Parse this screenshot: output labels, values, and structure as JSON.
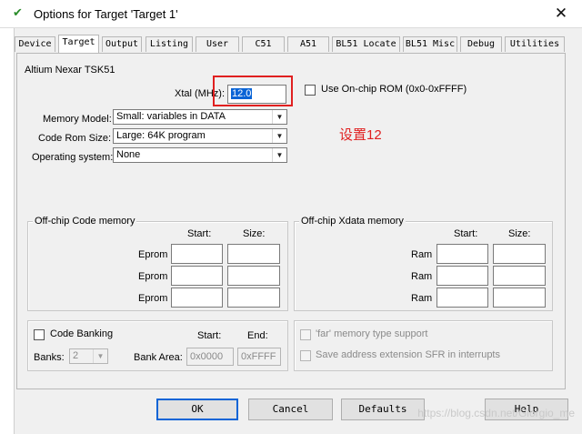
{
  "window": {
    "title": "Options for Target 'Target 1'",
    "icon": "keil-target-icon",
    "close_glyph": "✕"
  },
  "tabs": [
    {
      "label": "Device",
      "active": false
    },
    {
      "label": "Target",
      "active": true
    },
    {
      "label": "Output",
      "active": false
    },
    {
      "label": "Listing",
      "active": false
    },
    {
      "label": "User",
      "active": false
    },
    {
      "label": "C51",
      "active": false
    },
    {
      "label": "A51",
      "active": false
    },
    {
      "label": "BL51 Locate",
      "active": false
    },
    {
      "label": "BL51 Misc",
      "active": false
    },
    {
      "label": "Debug",
      "active": false
    },
    {
      "label": "Utilities",
      "active": false
    }
  ],
  "target": {
    "device_name": "Altium Nexar TSK51",
    "xtal_label": "Xtal (MHz):",
    "xtal_value": "12.0",
    "onchip_rom_label": "Use On-chip ROM (0x0-0xFFFF)",
    "onchip_rom_checked": false,
    "memory_model_label": "Memory Model:",
    "memory_model_value": "Small: variables in DATA",
    "code_rom_label": "Code Rom Size:",
    "code_rom_value": "Large: 64K program",
    "os_label": "Operating system:",
    "os_value": "None"
  },
  "annotation": {
    "text": "设置12",
    "color": "#e02020"
  },
  "offchip_code": {
    "title": "Off-chip Code memory",
    "start_header": "Start:",
    "size_header": "Size:",
    "rows": [
      {
        "label": "Eprom",
        "start": "",
        "size": ""
      },
      {
        "label": "Eprom",
        "start": "",
        "size": ""
      },
      {
        "label": "Eprom",
        "start": "",
        "size": ""
      }
    ]
  },
  "offchip_xdata": {
    "title": "Off-chip Xdata memory",
    "start_header": "Start:",
    "size_header": "Size:",
    "rows": [
      {
        "label": "Ram",
        "start": "",
        "size": ""
      },
      {
        "label": "Ram",
        "start": "",
        "size": ""
      },
      {
        "label": "Ram",
        "start": "",
        "size": ""
      }
    ]
  },
  "code_banking": {
    "label": "Code Banking",
    "checked": false,
    "start_header": "Start:",
    "end_header": "End:",
    "banks_label": "Banks:",
    "banks_value": "2",
    "bank_area_label": "Bank Area:",
    "bank_area_start": "0x0000",
    "bank_area_end": "0xFFFF"
  },
  "options": {
    "far_memory_label": "'far' memory type support",
    "save_sfr_label": "Save address extension SFR in interrupts"
  },
  "buttons": {
    "ok": "OK",
    "cancel": "Cancel",
    "defaults": "Defaults",
    "help": "Help"
  },
  "watermark": "https://blog.csdn.net/Giorgio_me"
}
